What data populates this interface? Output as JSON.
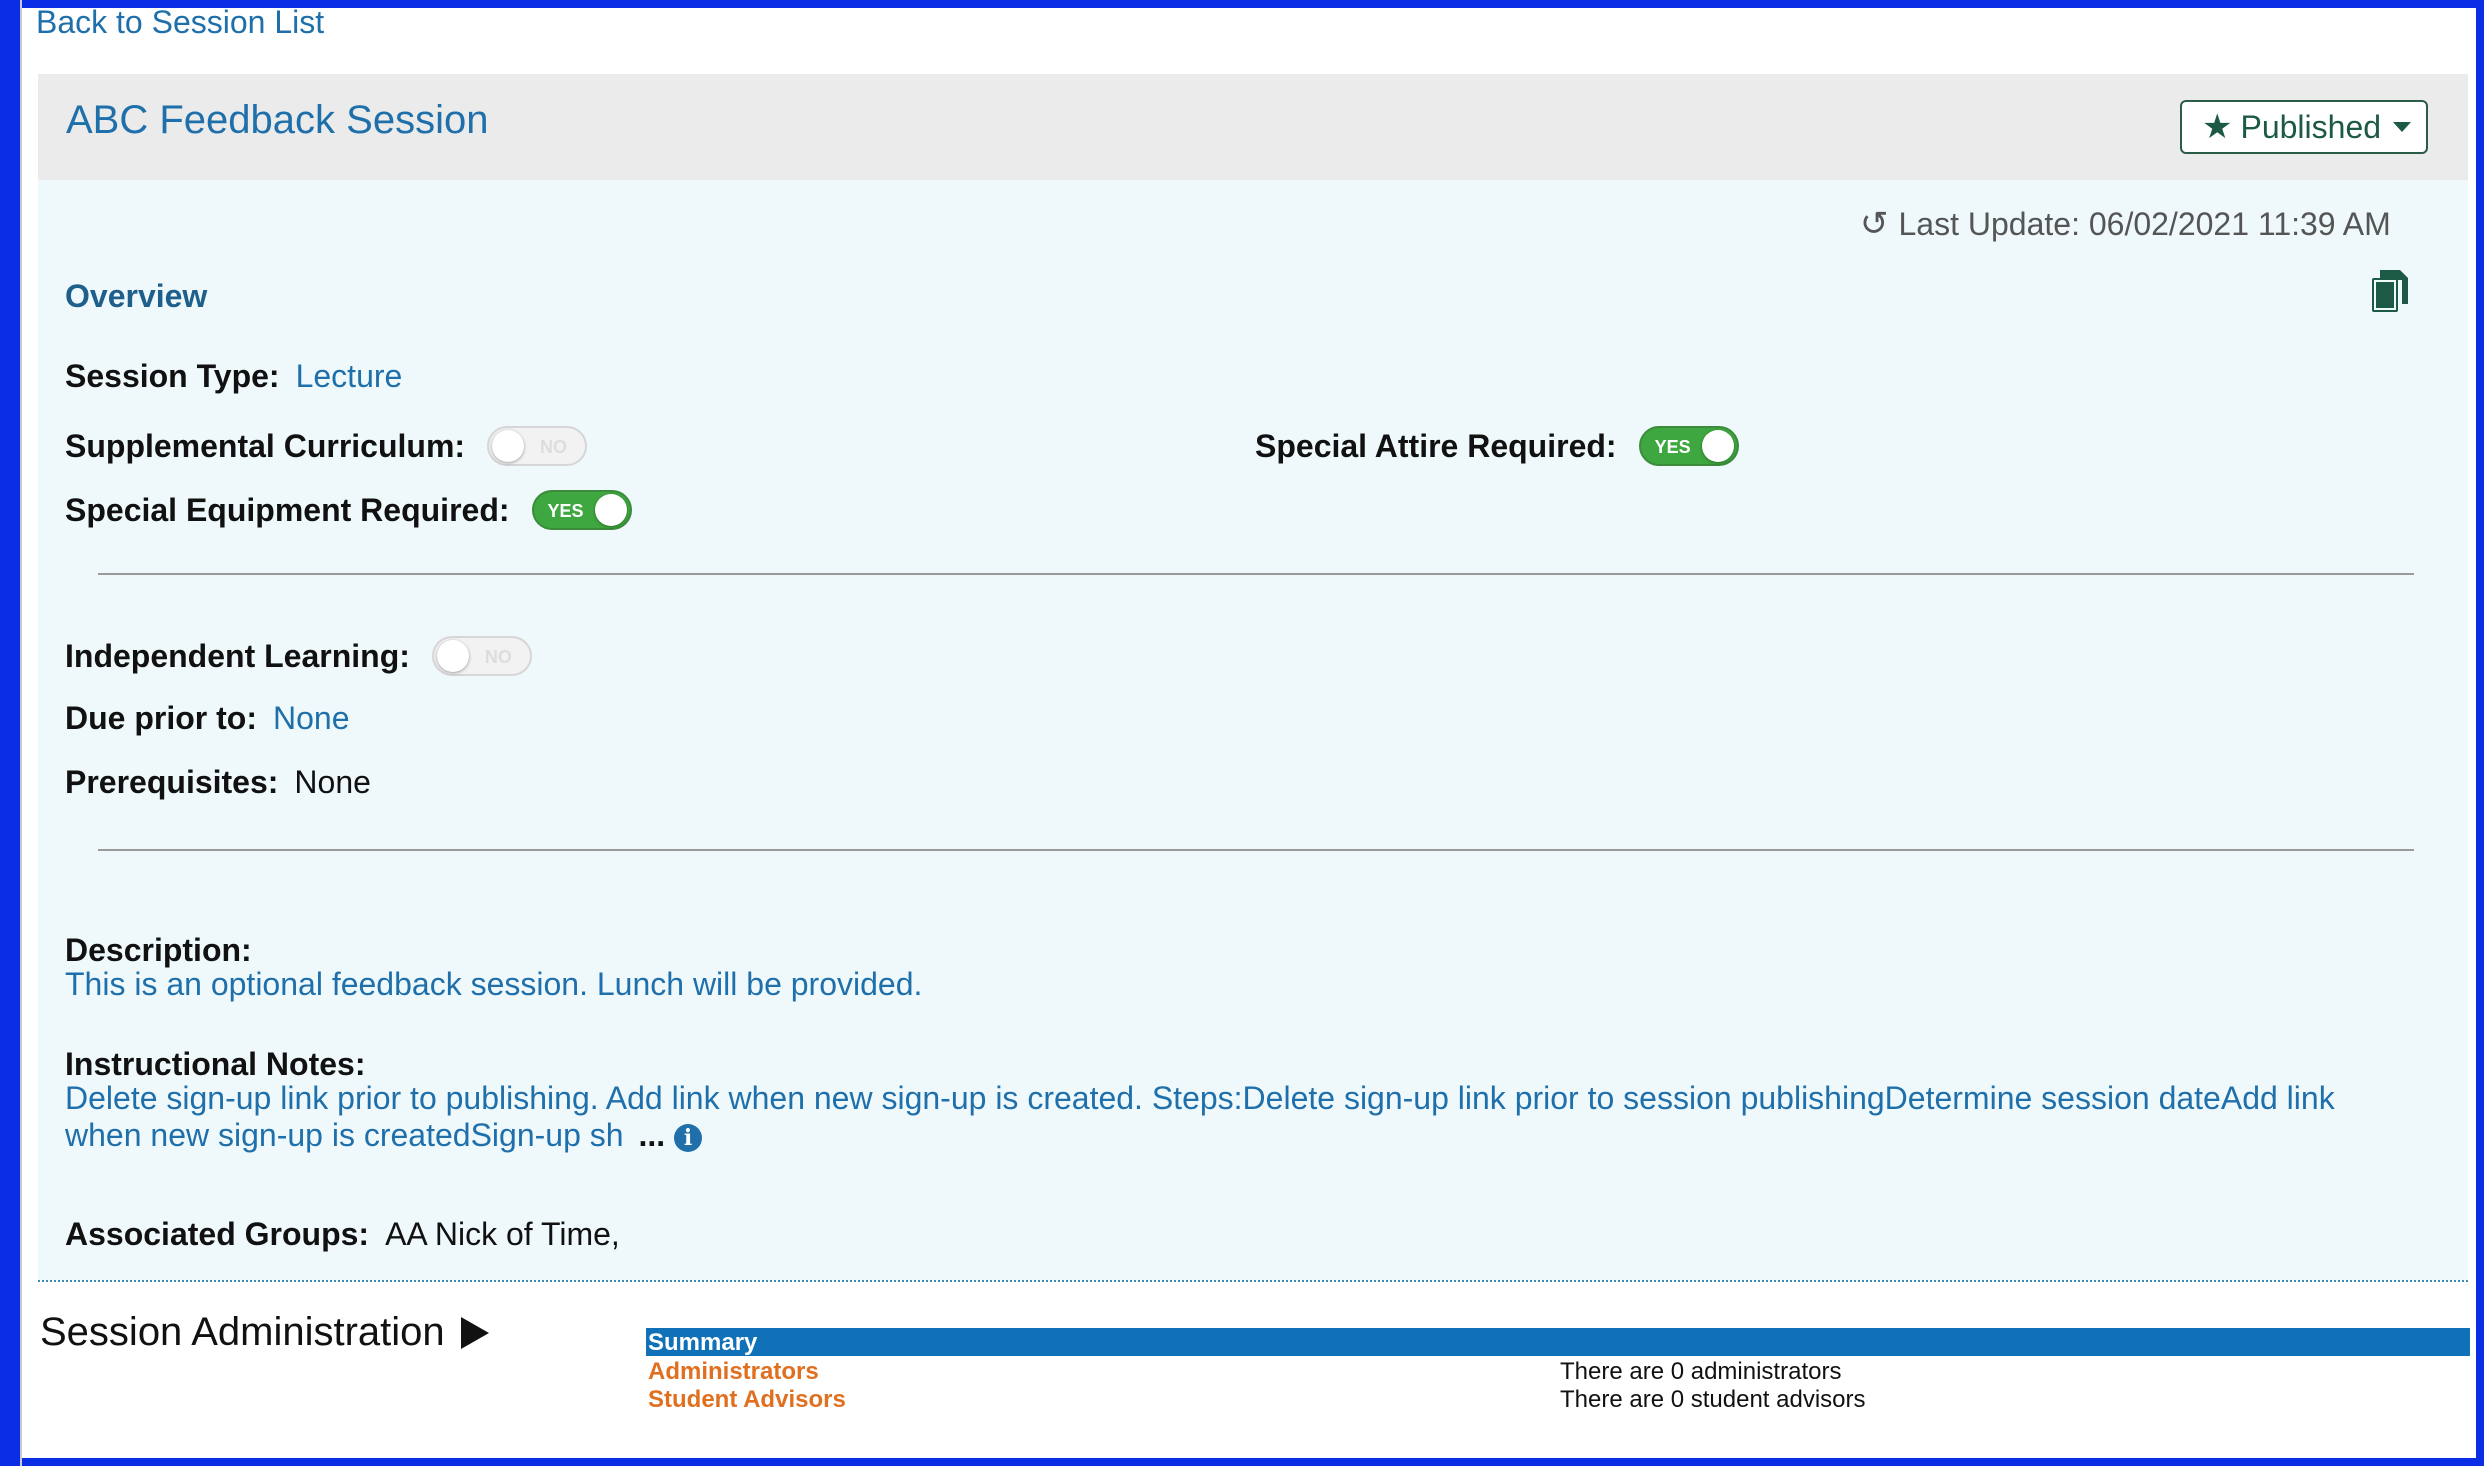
{
  "nav": {
    "back_label": "Back to Session List"
  },
  "header": {
    "title": "ABC Feedback Session",
    "status_label": "Published"
  },
  "meta": {
    "last_update": "Last Update: 06/02/2021 11:39 AM"
  },
  "overview": {
    "heading": "Overview",
    "session_type": {
      "label": "Session Type:",
      "value": "Lecture"
    },
    "supplemental_curriculum": {
      "label": "Supplemental Curriculum:",
      "toggle": "NO"
    },
    "special_attire": {
      "label": "Special Attire Required:",
      "toggle": "YES"
    },
    "special_equipment": {
      "label": "Special Equipment Required:",
      "toggle": "YES"
    },
    "independent_learning": {
      "label": "Independent Learning:",
      "toggle": "NO"
    },
    "due_prior_to": {
      "label": "Due prior to:",
      "value": "None"
    },
    "prerequisites": {
      "label": "Prerequisites:",
      "value": "None"
    }
  },
  "description": {
    "label": "Description:",
    "text": "This is an optional feedback session. Lunch will be provided."
  },
  "instructional_notes": {
    "label": "Instructional Notes:",
    "text": "Delete sign-up link prior to publishing. Add link when new sign-up is created. Steps:Delete sign-up link prior to session publishingDetermine session dateAdd link when new sign-up is createdSign-up sh",
    "ellipsis": "..."
  },
  "groups": {
    "label": "Associated Groups:",
    "value": "AA Nick of Time,"
  },
  "session_admin": {
    "title": "Session Administration",
    "summary_label": "Summary",
    "rows": [
      {
        "name": "Administrators",
        "value": "There are 0 administrators"
      },
      {
        "name": "Student Advisors",
        "value": "There are 0 student advisors"
      }
    ]
  },
  "colors": {
    "brand": "#1f6fab",
    "status": "#1d5a45",
    "toggle_on": "#3fa73f",
    "summary_bar": "#1070b8",
    "link_orange": "#e07020"
  }
}
